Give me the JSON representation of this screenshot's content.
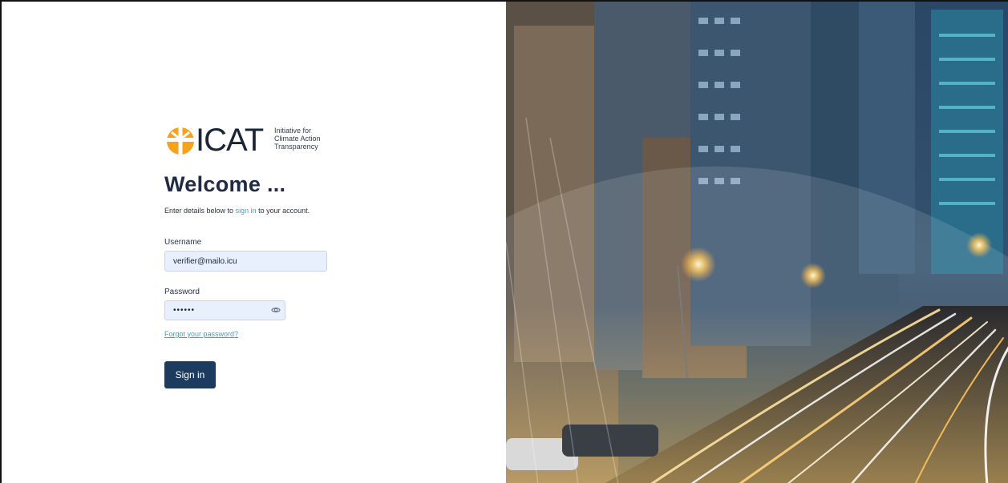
{
  "brand": {
    "logo_text": "ICAT",
    "tagline": [
      "Initiative for",
      "Climate Action",
      "Transparency"
    ],
    "colors": {
      "orange": "#f7a21b",
      "navy": "#1d3b5f",
      "link": "#3ea3c0"
    }
  },
  "login": {
    "title": "Welcome ...",
    "intro_prefix": "Enter details below to ",
    "intro_link": "sign in",
    "intro_suffix": " to your account.",
    "username_label": "Username",
    "username_value": "verifier@mailo.icu",
    "password_label": "Password",
    "password_value": "••••••",
    "forgot_link": "Forgot your password?",
    "submit_label": "Sign in"
  },
  "icons": {
    "password_toggle": "eye-icon"
  }
}
